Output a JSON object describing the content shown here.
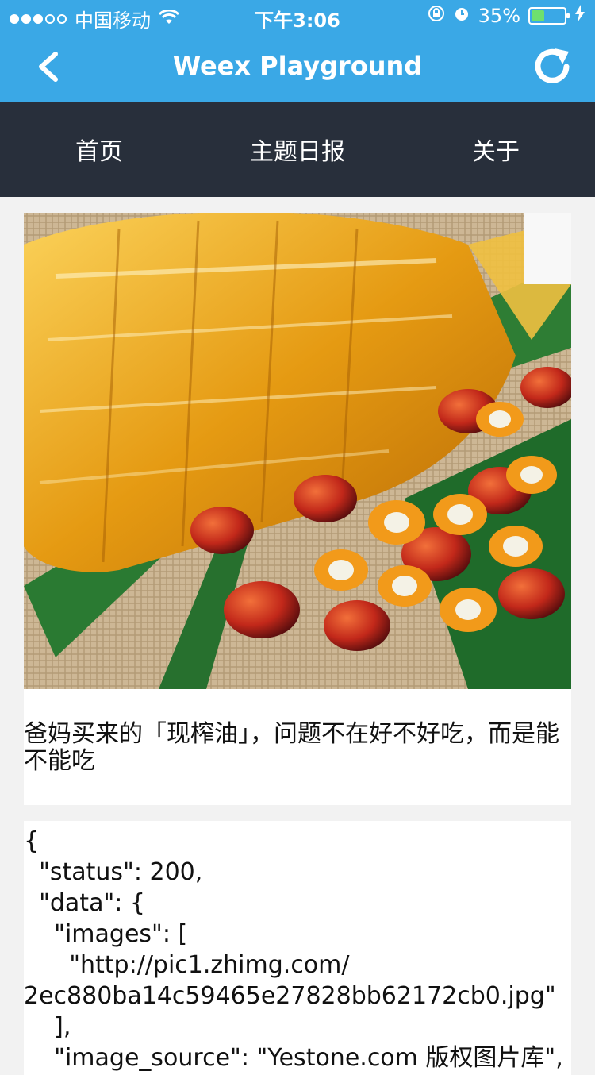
{
  "status_bar": {
    "carrier": "中国移动",
    "time": "下午3:06",
    "battery_percent": "35%",
    "battery_level": 0.35,
    "icons": [
      "signal-icon",
      "wifi-icon",
      "rotation-lock-icon",
      "alarm-icon",
      "battery-icon",
      "charging-icon"
    ]
  },
  "nav": {
    "title": "Weex Playground",
    "back_icon": "chevron-left-icon",
    "refresh_icon": "refresh-icon"
  },
  "tabs": [
    {
      "label": "首页"
    },
    {
      "label": "主题日报"
    },
    {
      "label": "关于"
    }
  ],
  "article": {
    "headline": "爸妈买来的「现榨油」，问题不在好不好吃，而是能不能吃"
  },
  "json_text": "{\n  \"status\": 200,\n  \"data\": {\n    \"images\": [\n      \"http://pic1.zhimg.com/\n2ec880ba14c59465e27828bb62172cb0.jpg\"\n    ],\n    \"image_source\": \"Yestone.com 版权图片库\","
}
